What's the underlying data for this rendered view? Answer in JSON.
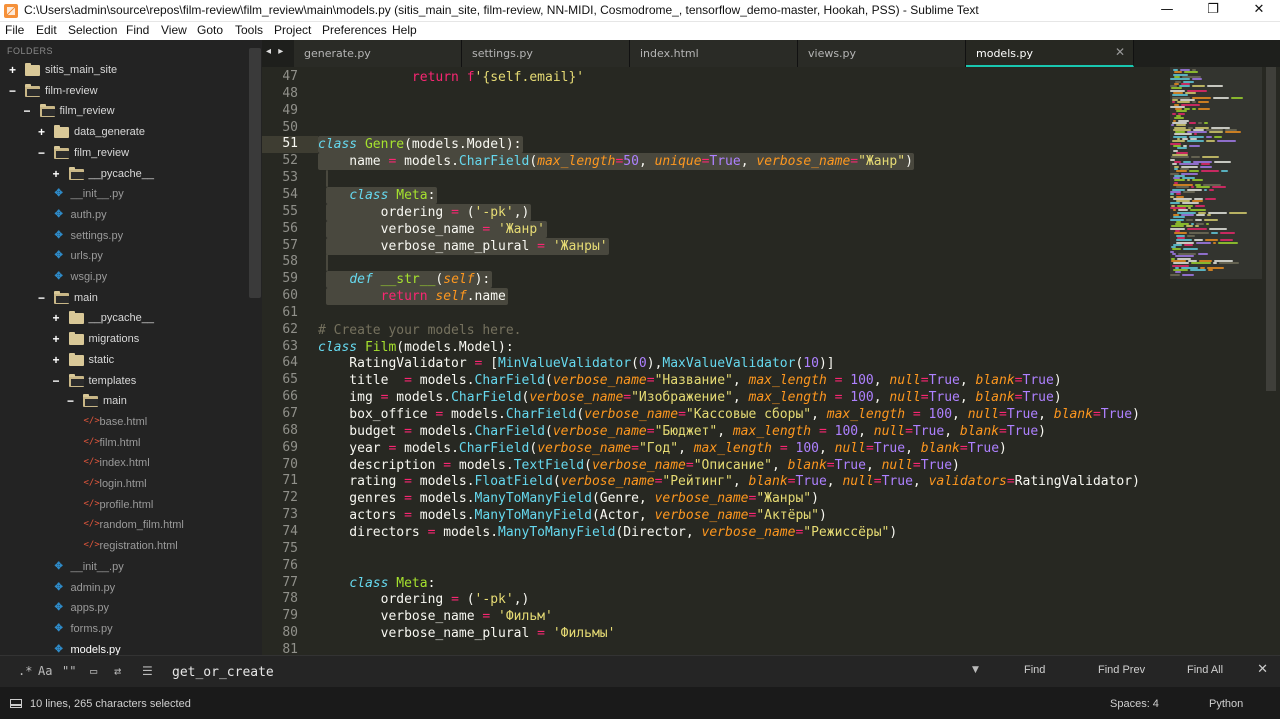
{
  "window": {
    "title": "C:\\Users\\admin\\source\\repos\\film-review\\film_review\\main\\models.py (sitis_main_site, film-review, NN-MIDI, Cosmodrome_, tensorflow_demo-master, Hookah, PSS) - Sublime Text",
    "minimize": "—",
    "maximize": "❐",
    "close": "✕"
  },
  "menu": [
    "File",
    "Edit",
    "Selection",
    "Find",
    "View",
    "Goto",
    "Tools",
    "Project",
    "Preferences",
    "Help"
  ],
  "sidebar": {
    "header": "FOLDERS",
    "items": [
      {
        "label": "sitis_main_site",
        "kind": "folder",
        "toggle": "+",
        "depth": 0
      },
      {
        "label": "film-review",
        "kind": "folder-open",
        "toggle": "−",
        "depth": 0
      },
      {
        "label": "film_review",
        "kind": "folder-open",
        "toggle": "−",
        "depth": 1
      },
      {
        "label": "data_generate",
        "kind": "folder",
        "toggle": "+",
        "depth": 2
      },
      {
        "label": "film_review",
        "kind": "folder-open",
        "toggle": "−",
        "depth": 2
      },
      {
        "label": "__pycache__",
        "kind": "folder-open",
        "toggle": "+",
        "depth": 3
      },
      {
        "label": "__init__.py",
        "kind": "py",
        "depth": 3
      },
      {
        "label": "auth.py",
        "kind": "py",
        "depth": 3
      },
      {
        "label": "settings.py",
        "kind": "py",
        "depth": 3
      },
      {
        "label": "urls.py",
        "kind": "py",
        "depth": 3
      },
      {
        "label": "wsgi.py",
        "kind": "py",
        "depth": 3
      },
      {
        "label": "main",
        "kind": "folder-open",
        "toggle": "−",
        "depth": 2
      },
      {
        "label": "__pycache__",
        "kind": "folder",
        "toggle": "+",
        "depth": 3
      },
      {
        "label": "migrations",
        "kind": "folder",
        "toggle": "+",
        "depth": 3
      },
      {
        "label": "static",
        "kind": "folder",
        "toggle": "+",
        "depth": 3
      },
      {
        "label": "templates",
        "kind": "folder-open",
        "toggle": "−",
        "depth": 3
      },
      {
        "label": "main",
        "kind": "folder-open",
        "toggle": "−",
        "depth": 4
      },
      {
        "label": "base.html",
        "kind": "html",
        "depth": 5
      },
      {
        "label": "film.html",
        "kind": "html",
        "depth": 5
      },
      {
        "label": "index.html",
        "kind": "html",
        "depth": 5
      },
      {
        "label": "login.html",
        "kind": "html",
        "depth": 5
      },
      {
        "label": "profile.html",
        "kind": "html",
        "depth": 5
      },
      {
        "label": "random_film.html",
        "kind": "html",
        "depth": 5
      },
      {
        "label": "registration.html",
        "kind": "html",
        "depth": 5
      },
      {
        "label": "__init__.py",
        "kind": "py",
        "depth": 3
      },
      {
        "label": "admin.py",
        "kind": "py",
        "depth": 3
      },
      {
        "label": "apps.py",
        "kind": "py",
        "depth": 3
      },
      {
        "label": "forms.py",
        "kind": "py",
        "depth": 3
      },
      {
        "label": "models.py",
        "kind": "py",
        "depth": 3,
        "active": true
      }
    ]
  },
  "tabs": {
    "arrows": "◂ ▸",
    "items": [
      {
        "label": "generate.py",
        "active": false
      },
      {
        "label": "settings.py",
        "active": false
      },
      {
        "label": "index.html",
        "active": false
      },
      {
        "label": "views.py",
        "active": false
      },
      {
        "label": "models.py",
        "active": true
      }
    ],
    "close_glyph": "✕"
  },
  "editor": {
    "current_line": 51,
    "line_numbers": [
      "47",
      "48",
      "49",
      "50",
      "51",
      "52",
      "53",
      "54",
      "55",
      "56",
      "57",
      "58",
      "59",
      "60",
      "61",
      "62",
      "63",
      "64",
      "65",
      "66",
      "67",
      "68",
      "69",
      "70",
      "71",
      "72",
      "73",
      "74",
      "75",
      "76",
      "77",
      "78",
      "79",
      "80",
      "81"
    ],
    "lines": [
      "            return f'{self.email}'",
      "",
      "",
      "",
      "class Genre(models.Model):",
      "    name = models.CharField(max_length=50, unique=True, verbose_name=\"Жанр\")",
      "",
      "    class Meta:",
      "        ordering = ('-pk',)",
      "        verbose_name = 'Жанр'",
      "        verbose_name_plural = 'Жанры'",
      "",
      "    def __str__(self):",
      "        return self.name",
      "",
      "# Create your models here.",
      "class Film(models.Model):",
      "    RatingValidator = [MinValueValidator(0),MaxValueValidator(10)]",
      "    title  = models.CharField(verbose_name=\"Название\", max_length = 100, null=True, blank=True)",
      "    img = models.CharField(verbose_name=\"Изображение\", max_length = 100, null=True, blank=True)",
      "    box_office = models.CharField(verbose_name=\"Кассовые сборы\", max_length = 100, null=True, blank=True)",
      "    budget = models.CharField(verbose_name=\"Бюджет\", max_length = 100, null=True, blank=True)",
      "    year = models.CharField(verbose_name=\"Год\", max_length = 100, null=True, blank=True)",
      "    description = models.TextField(verbose_name=\"Описание\", blank=True, null=True)",
      "    rating = models.FloatField(verbose_name=\"Рейтинг\", blank=True, null=True, validators=RatingValidator)",
      "    genres = models.ManyToManyField(Genre, verbose_name=\"Жанры\")",
      "    actors = models.ManyToManyField(Actor, verbose_name=\"Актёры\")",
      "    directors = models.ManyToManyField(Director, verbose_name=\"Режиссёры\")",
      "",
      "",
      "    class Meta:",
      "        ordering = ('-pk',)",
      "        verbose_name = 'Фильм'",
      "        verbose_name_plural = 'Фильмы'",
      ""
    ]
  },
  "find": {
    "options": [
      ".*",
      "Aa",
      "\"\"",
      "▭",
      "⇄",
      "☰"
    ],
    "value": "get_or_create",
    "dropdown": "▼",
    "find_label": "Find",
    "find_prev_label": "Find Prev",
    "find_all_label": "Find All",
    "close": "✕"
  },
  "status": {
    "selection": "10 lines, 265 characters selected",
    "indent": "Spaces: 4",
    "syntax": "Python"
  }
}
